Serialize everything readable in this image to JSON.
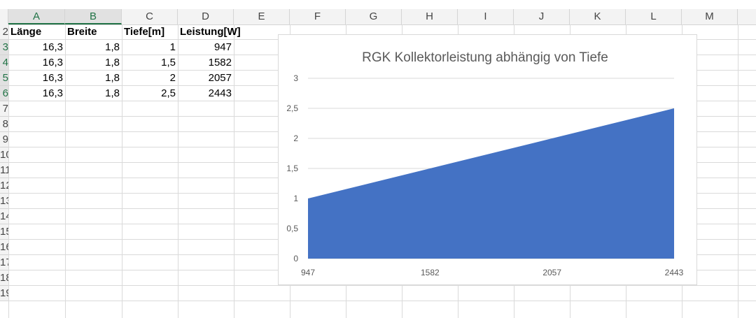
{
  "sheet": {
    "columns": [
      "A",
      "B",
      "C",
      "D",
      "E",
      "F",
      "G",
      "H",
      "I",
      "J",
      "K",
      "L",
      "M"
    ],
    "rows": [
      "2",
      "3",
      "4",
      "5",
      "6",
      "7",
      "8",
      "9",
      "10",
      "11",
      "12",
      "13",
      "14",
      "15",
      "16",
      "17",
      "18",
      "19"
    ],
    "header_row": [
      "Länge",
      "Breite",
      "Tiefe[m]",
      "Leistung[W]"
    ],
    "data_rows": [
      [
        "16,3",
        "1,8",
        "1",
        "947"
      ],
      [
        "16,3",
        "1,8",
        "1,5",
        "1582"
      ],
      [
        "16,3",
        "1,8",
        "2",
        "2057"
      ],
      [
        "16,3",
        "1,8",
        "2,5",
        "2443"
      ]
    ]
  },
  "chart_data": {
    "type": "area",
    "title": "RGK Kollektorleistung abhängig von Tiefe",
    "categories": [
      "947",
      "1582",
      "2057",
      "2443"
    ],
    "series": [
      {
        "values": [
          1,
          1.5,
          2,
          2.5
        ],
        "color": "#4472c4"
      }
    ],
    "y_ticks": [
      "0",
      "0,5",
      "1",
      "1,5",
      "2",
      "2,5",
      "3"
    ],
    "ylim": [
      0,
      3
    ],
    "grid": true,
    "legend": "none"
  }
}
